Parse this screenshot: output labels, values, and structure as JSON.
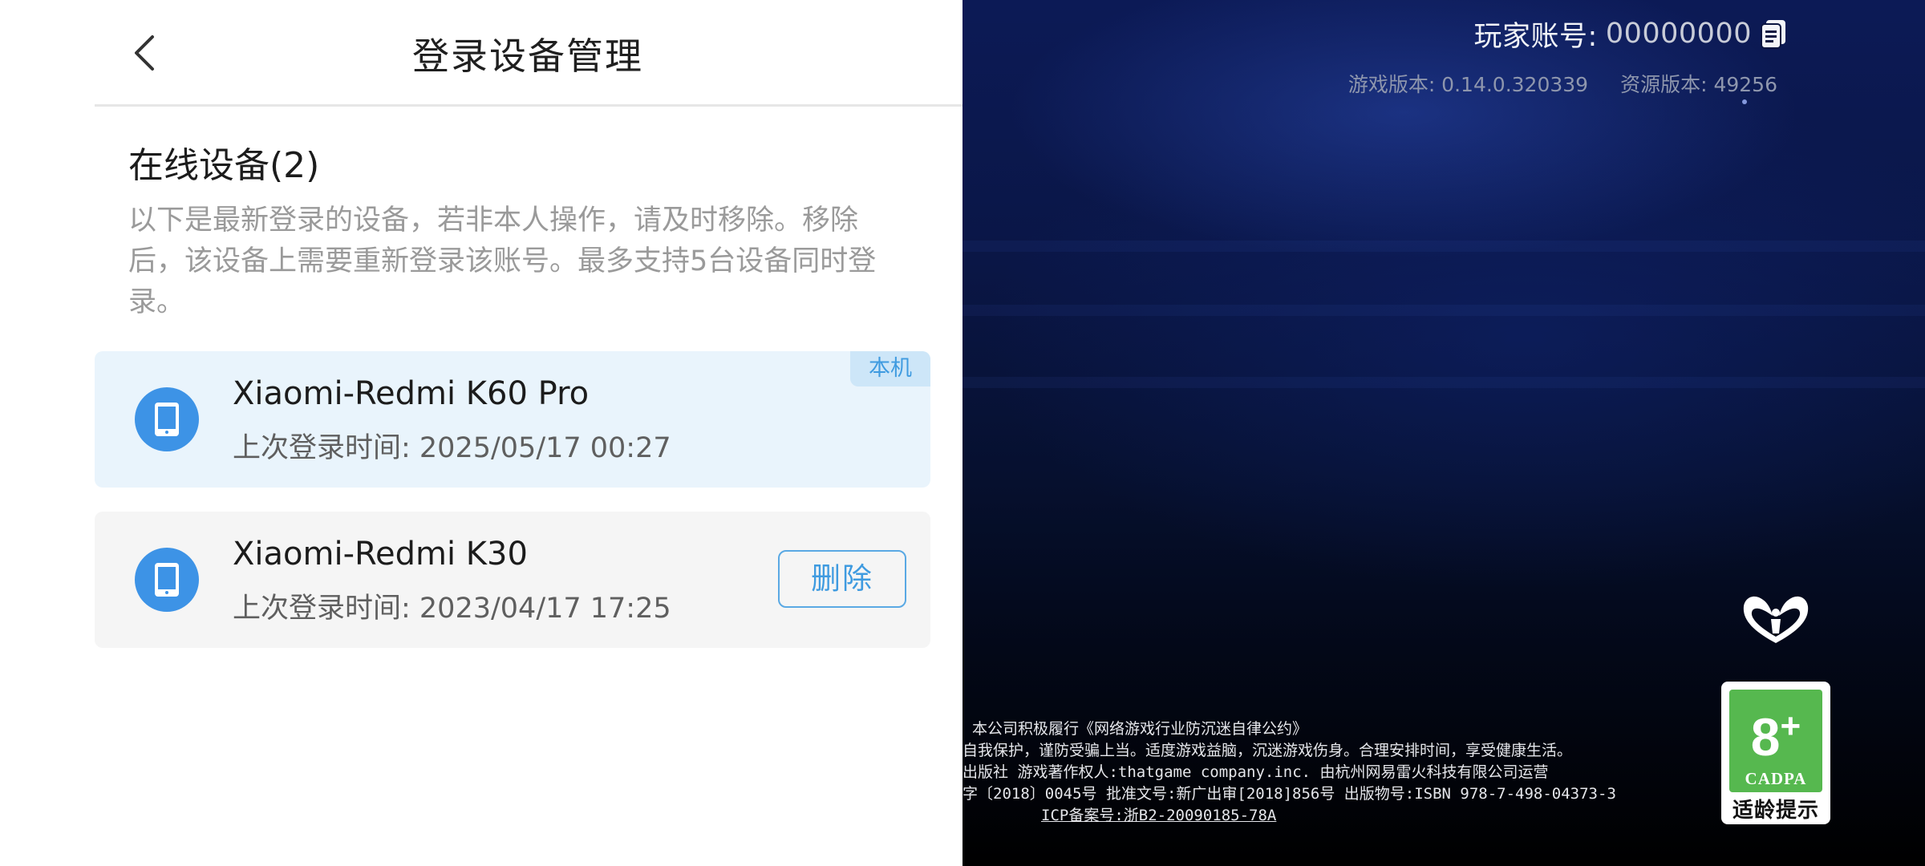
{
  "game": {
    "player_id_label": "玩家账号:",
    "player_id_value": "00000000",
    "game_version": "游戏版本: 0.14.0.320339",
    "resource_version": "资源版本: 49256",
    "legal_lines": [
      "本公司积极履行《网络游戏行业防沉迷自律公约》",
      "自我保护，谨防受骗上当。适度游戏益脑，沉迷游戏伤身。合理安排时间，享受健康生活。",
      "出版社 游戏著作权人:thatgame company.inc. 由杭州网易雷火科技有限公司运营",
      "字〔2018〕0045号 批准文号:新广出审[2018]856号 出版物号:ISBN 978-7-498-04373-3"
    ],
    "icp": "ICP备案号:浙B2-20090185-78A",
    "age_rating": {
      "number": "8",
      "plus": "+",
      "org": "CADPA",
      "hint": "适龄提示"
    }
  },
  "panel": {
    "title": "登录设备管理",
    "section_title": "在线设备(2)",
    "description": "以下是最新登录的设备，若非本人操作，请及时移除。移除后，该设备上需要重新登录该账号。最多支持5台设备同时登录。",
    "devices": [
      {
        "name": "Xiaomi-Redmi K60 Pro",
        "time": "上次登录时间: 2025/05/17 00:27",
        "badge": "本机"
      },
      {
        "name": "Xiaomi-Redmi K30",
        "time": "上次登录时间: 2023/04/17 17:25",
        "action": "删除"
      }
    ]
  },
  "colors": {
    "accent": "#3f9be0",
    "current_card_bg": "#e9f4fc",
    "other_card_bg": "#f5f5f5",
    "age_green": "#56b84f"
  },
  "icons": {
    "back": "chevron-left-icon",
    "copy": "copy-icon",
    "device": "phone-icon",
    "family": "family-protection-icon"
  }
}
